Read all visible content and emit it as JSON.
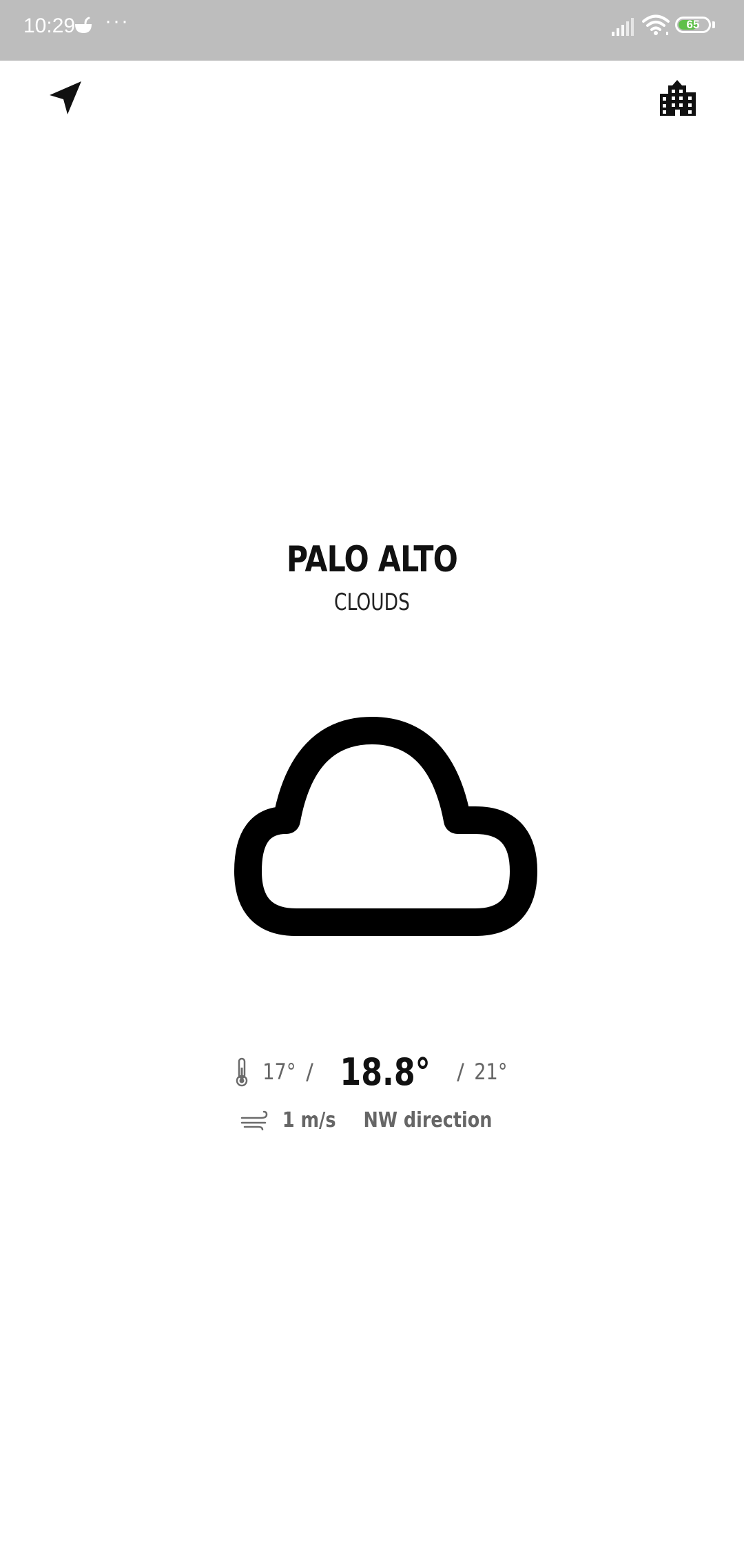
{
  "status_bar": {
    "time": "10:29",
    "more": "···",
    "battery_level": "65",
    "battery_fraction": 0.65,
    "battery_color": "#5fc04a",
    "background_color": "#bdbdbd"
  },
  "nav": {
    "locate_icon": "navigation-arrow-icon",
    "city_icon": "city-buildings-icon"
  },
  "weather": {
    "city": "PALO ALTO",
    "condition": "CLOUDS",
    "icon": "cloud-icon",
    "temp_min": "17°",
    "temp_current": "18.8°",
    "temp_max": "21°",
    "wind_speed": "1 m/s",
    "wind_direction": "NW direction"
  }
}
